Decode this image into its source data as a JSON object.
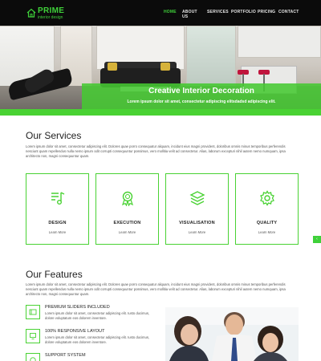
{
  "header": {
    "logo_name": "PRIME",
    "logo_tagline": "interior design",
    "nav": [
      {
        "label": "HOME",
        "active": true
      },
      {
        "label": "ABOUT US",
        "active": false
      },
      {
        "label": "SERVICES",
        "active": false
      },
      {
        "label": "PORTFOLIO",
        "active": false
      },
      {
        "label": "PRICING",
        "active": false
      },
      {
        "label": "CONTACT",
        "active": false
      }
    ]
  },
  "hero": {
    "title": "Creative Interior Decoration",
    "subtitle": "Lorem ipsum dolor sit amet, consectetur adipiscing elitsdadsd adipiscing elit."
  },
  "services": {
    "title": "Our Services",
    "description": "Lorem ipsum dolor sit amet, consectetur adipiscing elit. Dolores quae porro consequatur aliquam, incidunt eius magni provident, doloribus omnis minus temporibus perferendis nesciunt quam repellendus nulla nemo ipsum odit corrupti consequuntur possimus, vero mollitia velit ad consectetur. Alias, laborum excepturi nihil autem nemo numquam, ipsa architecto non, magni consequuntur quam.",
    "cards": [
      {
        "title": "DESIGN",
        "link": "Learn More",
        "icon": "music-note-icon"
      },
      {
        "title": "EXECUTION",
        "link": "Learn More",
        "icon": "award-ribbon-icon"
      },
      {
        "title": "VISUALISATION",
        "link": "Learn More",
        "icon": "layers-icon"
      },
      {
        "title": "QUALITY",
        "link": "Learn More",
        "icon": "gear-icon"
      }
    ]
  },
  "features": {
    "title": "Our Features",
    "description": "Lorem ipsum dolor sit amet, consectetur adipiscing elit. Dolores quae porro consequatur aliquam, incidunt eius magni provident, doloribus omnis minus temporibus perferendis nesciunt quam repellendus nulla nemo ipsum odit corrupti consequuntur possimus, vero mollitia velit ad consectetur. Alias, laborum excepturi nihil autem nemo numquam, ipsa architecto non, magni consequuntur quam.",
    "items": [
      {
        "title": "PREMIUM SLIDERS INCLUDED",
        "text": "Lorem ipsum dolor sit amet, consectetur adipiscing elit. Iusto ducimus, dolore voluptatum eos dolorem inventore.",
        "icon": "slider-icon"
      },
      {
        "title": "100% RESPONSIVE LAYOUT",
        "text": "Lorem ipsum dolor sit amet, consectetur adipiscing elit. Iusto ducimus, dolore voluptatum eos dolorem inventore.",
        "icon": "responsive-icon"
      },
      {
        "title": "SUPPORT SYSTEM",
        "text": "",
        "icon": "support-icon"
      }
    ]
  },
  "colors": {
    "accent": "#49d233",
    "header_bg": "#0b0b0b"
  }
}
